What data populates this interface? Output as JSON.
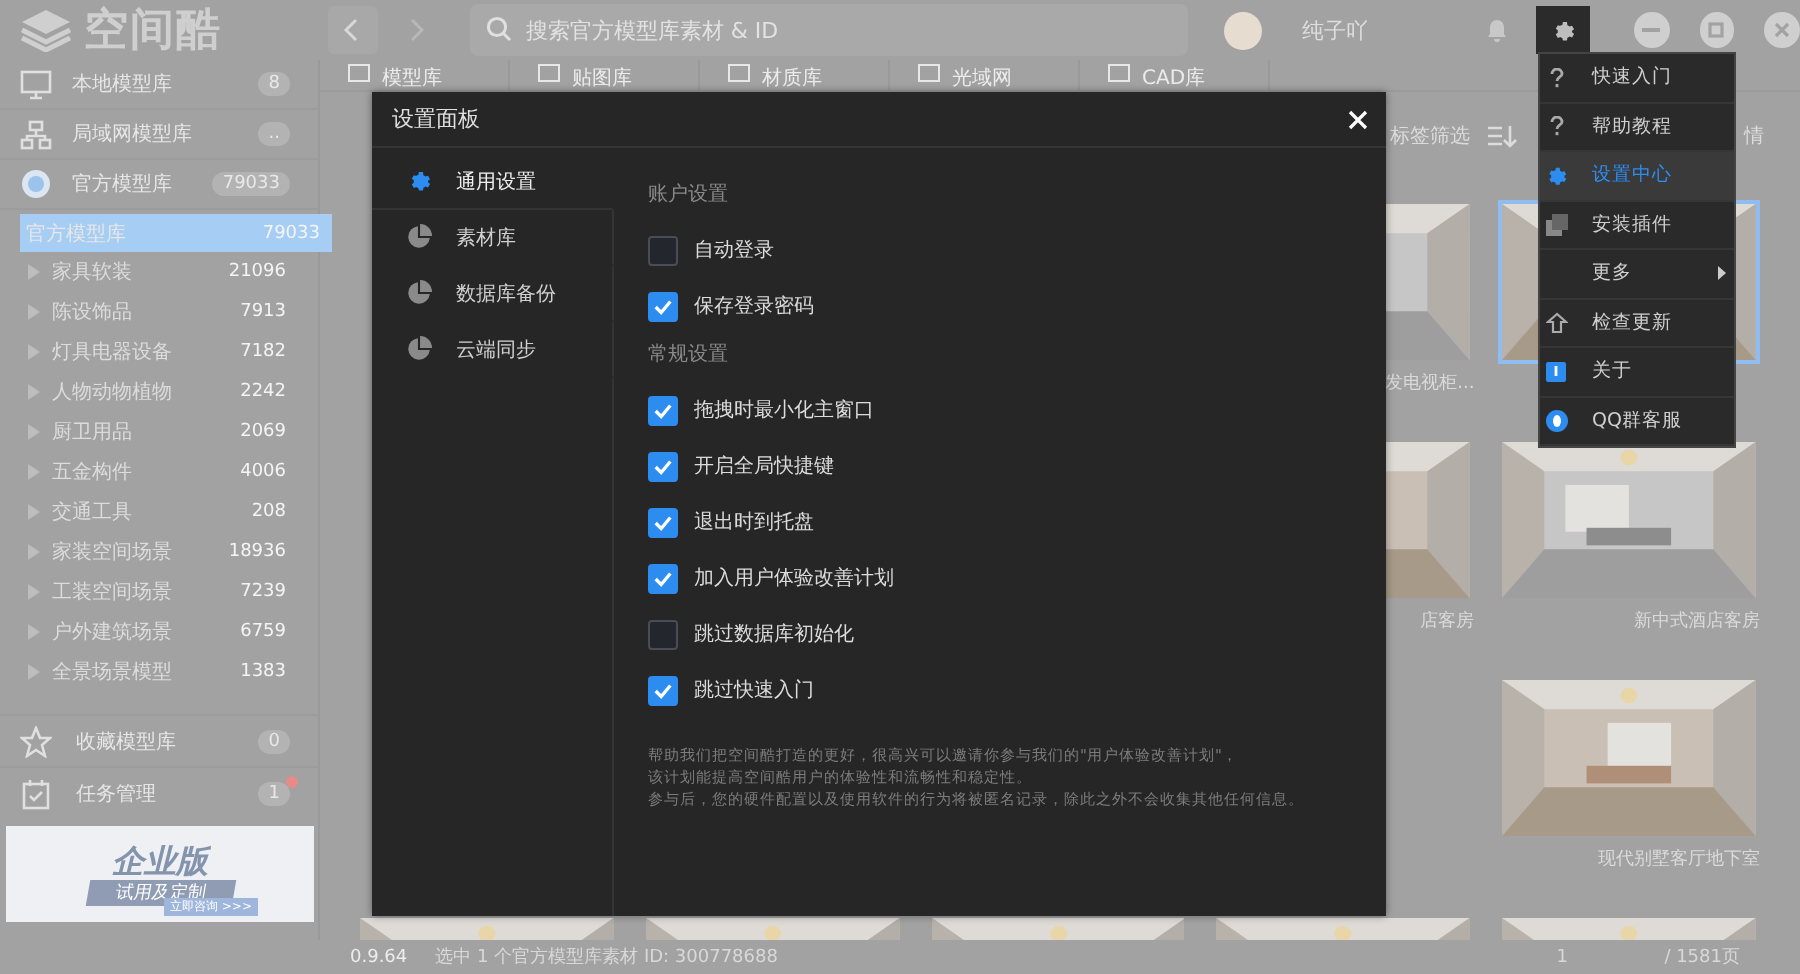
{
  "header": {
    "logo": "空间酷",
    "search": {
      "placeholder": "搜索官方模型库素材 & ID"
    },
    "username": "纯子吖",
    "settings_active": true
  },
  "sidebar": {
    "libraries": [
      {
        "kind": "monitor",
        "label": "本地模型库",
        "count": "8"
      },
      {
        "kind": "network",
        "label": "局域网模型库",
        "count": ".."
      },
      {
        "kind": "globe",
        "label": "官方模型库",
        "count": "79033"
      }
    ],
    "tree": {
      "label": "官方模型库",
      "count": "79033",
      "selected": true,
      "children": [
        {
          "label": "家具软装",
          "count": "21096",
          "expanded": false
        },
        {
          "label": "陈设饰品",
          "count": "7913",
          "expanded": false
        },
        {
          "label": "灯具电器设备",
          "count": "7182",
          "expanded": false
        },
        {
          "label": "人物动物植物",
          "count": "2242",
          "expanded": false
        },
        {
          "label": "厨卫用品",
          "count": "2069",
          "expanded": false
        },
        {
          "label": "五金构件",
          "count": "4006",
          "expanded": false
        },
        {
          "label": "交通工具",
          "count": "208",
          "expanded": false
        },
        {
          "label": "家装空间场景",
          "count": "18936",
          "expanded": false
        },
        {
          "label": "工装空间场景",
          "count": "7239",
          "expanded": false
        },
        {
          "label": "户外建筑场景",
          "count": "6759",
          "expanded": false
        },
        {
          "label": "全景场景模型",
          "count": "1383",
          "expanded": false
        }
      ]
    },
    "bottom": [
      {
        "kind": "star",
        "label": "收藏模型库",
        "count": "0",
        "alert": false
      },
      {
        "kind": "task",
        "label": "任务管理",
        "count": "1",
        "alert": true
      }
    ],
    "ad": {
      "title": "企业版",
      "subtitle": "试用及定制",
      "cta": "立即咨询 >>>"
    }
  },
  "tabs": [
    {
      "label": "模型库"
    },
    {
      "label": "贴图库"
    },
    {
      "label": "材质库"
    },
    {
      "label": "光域网"
    },
    {
      "label": "CAD库"
    }
  ],
  "toolbar": {
    "filter": "标签筛选",
    "detail": "情"
  },
  "grid": [
    [
      {
        "kind": "covered"
      },
      {
        "kind": "covered"
      },
      {
        "kind": "covered"
      },
      {
        "kind": "picture",
        "caption": "发电视柜...",
        "selected": false
      },
      {
        "kind": "picture",
        "selected": true
      }
    ],
    [
      {
        "kind": "covered"
      },
      {
        "kind": "covered"
      },
      {
        "kind": "covered"
      },
      {
        "kind": "picture",
        "caption": "店客房",
        "selected": false
      },
      {
        "kind": "picture",
        "caption": "新中式酒店客房",
        "selected": false
      }
    ],
    [
      {
        "kind": "covered"
      },
      {
        "kind": "covered"
      },
      {
        "kind": "covered"
      },
      {
        "kind": "covered"
      },
      {
        "kind": "picture",
        "caption": "现代别墅客厅地下室",
        "selected": false
      }
    ],
    [
      {
        "kind": "picture",
        "selected": false
      },
      {
        "kind": "picture",
        "selected": false
      },
      {
        "kind": "picture",
        "selected": false
      },
      {
        "kind": "picture",
        "selected": false
      },
      {
        "kind": "picture",
        "selected": false
      }
    ]
  ],
  "status": {
    "version": "0.9.64",
    "selection": "选中 1 个官方模型库素材 ID: 300778688",
    "page": "1",
    "pages": "/ 1581页"
  },
  "modal": {
    "title": "设置面板",
    "nav": [
      {
        "kind": "gear",
        "label": "通用设置",
        "selected": true
      },
      {
        "kind": "pie",
        "label": "素材库",
        "selected": false
      },
      {
        "kind": "pie",
        "label": "数据库备份",
        "selected": false
      },
      {
        "kind": "pie",
        "label": "云端同步",
        "selected": false
      }
    ],
    "sections": [
      {
        "title": "账户设置",
        "options": [
          {
            "label": "自动登录",
            "checked": false
          },
          {
            "label": "保存登录密码",
            "checked": true
          }
        ]
      },
      {
        "title": "常规设置",
        "options": [
          {
            "label": "拖拽时最小化主窗口",
            "checked": true
          },
          {
            "label": "开启全局快捷键",
            "checked": true
          },
          {
            "label": "退出时到托盘",
            "checked": true
          },
          {
            "label": "加入用户体验改善计划",
            "checked": true
          },
          {
            "label": "跳过数据库初始化",
            "checked": false
          },
          {
            "label": "跳过快速入门",
            "checked": true
          }
        ]
      }
    ],
    "note": [
      "帮助我们把空间酷打造的更好，很高兴可以邀请你参与我们的\"用户体验改善计划\"，",
      "该计划能提高空间酷用户的体验性和流畅性和稳定性。",
      "参与后，您的硬件配置以及使用软件的行为将被匿名记录，除此之外不会收集其他任何信息。"
    ]
  },
  "menu": [
    {
      "kind": "help",
      "label": "快速入门",
      "selected": false,
      "submenu": false
    },
    {
      "kind": "help",
      "label": "帮助教程",
      "selected": false,
      "submenu": false
    },
    {
      "kind": "gear",
      "label": "设置中心",
      "selected": true,
      "submenu": false
    },
    {
      "kind": "copy",
      "label": "安装插件",
      "selected": false,
      "submenu": false
    },
    {
      "kind": "none",
      "label": "更多",
      "selected": false,
      "submenu": true
    },
    {
      "kind": "upload",
      "label": "检查更新",
      "selected": false,
      "submenu": false
    },
    {
      "kind": "flag",
      "label": "关于",
      "selected": false,
      "submenu": false
    },
    {
      "kind": "qq",
      "label": "QQ群客服",
      "selected": false,
      "submenu": false
    }
  ]
}
